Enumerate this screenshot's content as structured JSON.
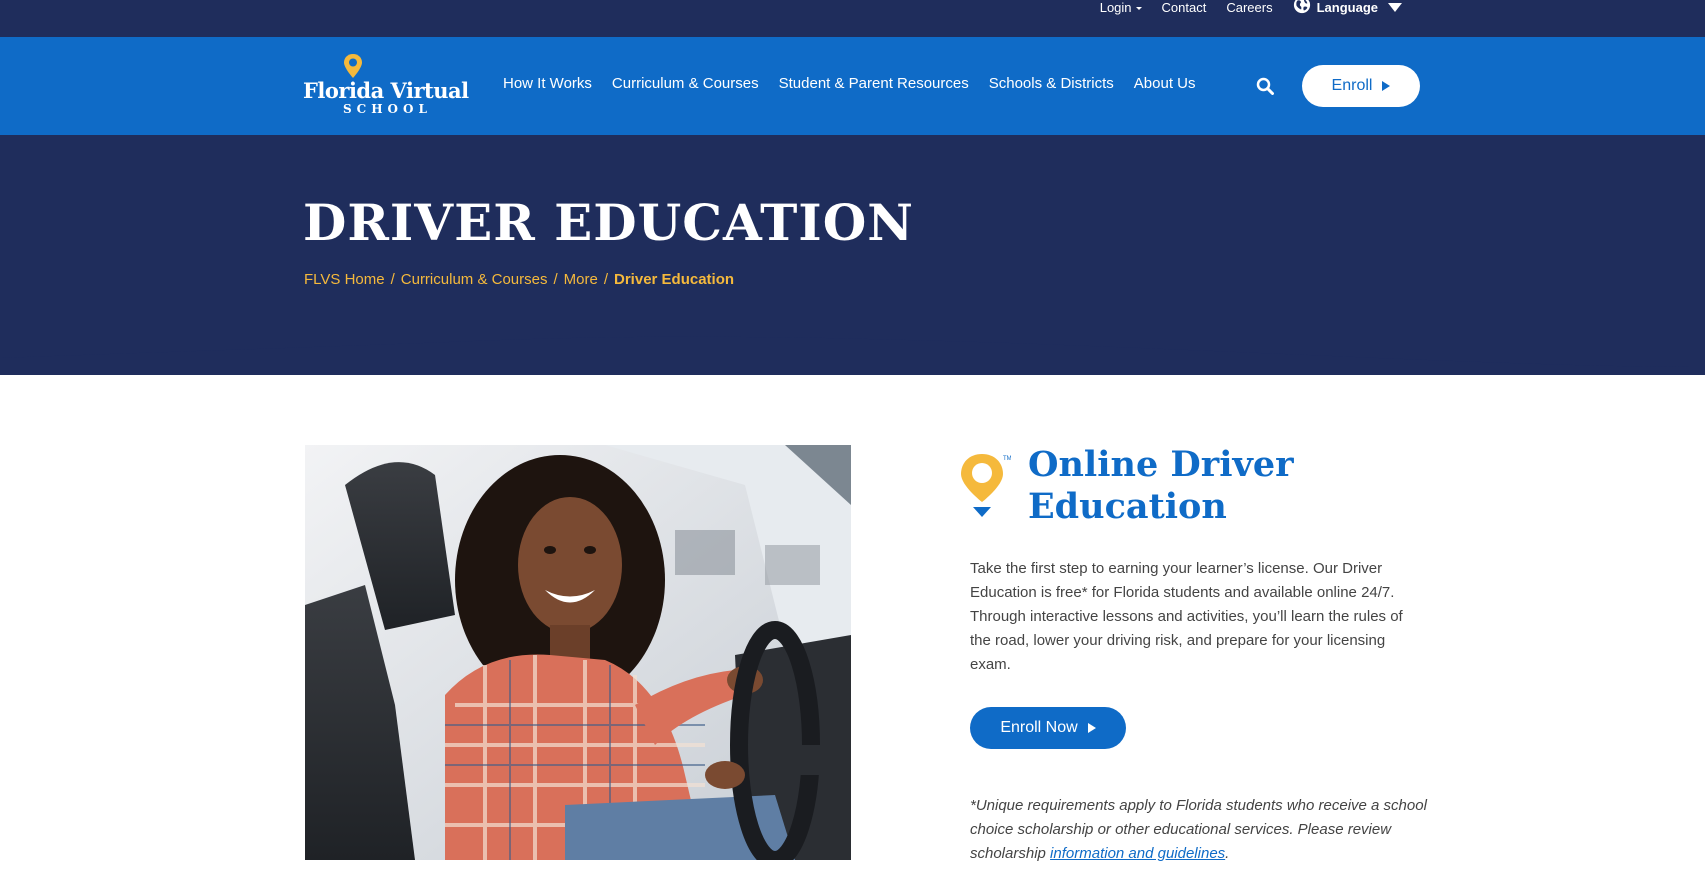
{
  "utility_bar": {
    "login": "Login",
    "contact": "Contact",
    "careers": "Careers",
    "language": "Language"
  },
  "brand": {
    "line1": "Florida Virtual",
    "line2": "SCHOOL"
  },
  "nav": {
    "items": [
      {
        "label": "How It Works"
      },
      {
        "label": "Curriculum & Courses"
      },
      {
        "label": "Student & Parent Resources"
      },
      {
        "label": "Schools & Districts"
      },
      {
        "label": "About Us"
      }
    ],
    "enroll_label": "Enroll"
  },
  "hero": {
    "title": "DRIVER EDUCATION",
    "breadcrumb": [
      {
        "label": "FLVS Home"
      },
      {
        "label": "Curriculum & Courses"
      },
      {
        "label": "More"
      }
    ],
    "breadcrumb_current": "Driver Education",
    "breadcrumb_separator": "/"
  },
  "promo": {
    "title": "Online Driver Education",
    "body": "Take the first step to earning your learner’s license. Our Driver Education is free* for Florida students and available online 24/7. Through interactive lessons and activities, you’ll learn the rules of the road, lower your driving risk, and prepare for your licensing exam.",
    "cta_label": "Enroll Now",
    "disclaimer_prefix": "*Unique requirements apply to Florida students who receive a school choice scholarship or other educational services. Please review scholarship ",
    "disclaimer_link": "information and guidelines",
    "disclaimer_suffix": "."
  },
  "colors": {
    "navy": "#1f2d5c",
    "brand_blue": "#0f6bc7",
    "accent_gold": "#f5b93c"
  },
  "icons": {
    "globe": "globe-icon",
    "search": "search-icon",
    "pin": "location-pin-icon"
  }
}
